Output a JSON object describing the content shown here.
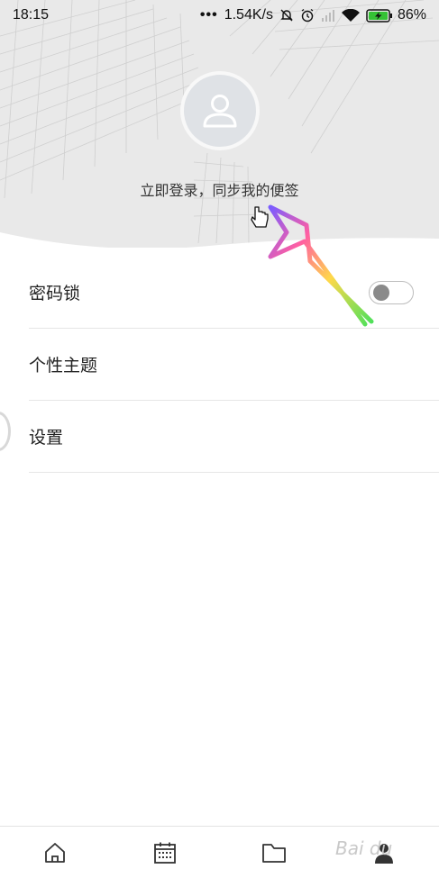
{
  "status_bar": {
    "time": "18:15",
    "dots": "•••",
    "network_speed": "1.54K/s",
    "battery_percent": "86%"
  },
  "header": {
    "login_prompt": "立即登录，同步我的便签"
  },
  "menu": {
    "items": [
      {
        "label": "密码锁",
        "has_toggle": true,
        "toggle_on": false
      },
      {
        "label": "个性主题"
      },
      {
        "label": "设置"
      }
    ]
  },
  "bottom_nav": {
    "items": [
      "home-icon",
      "calendar-icon",
      "folder-icon",
      "profile-icon"
    ]
  },
  "watermark": "Bai du",
  "colors": {
    "header_bg": "#e9e9e9",
    "avatar_bg": "#dfe2e6",
    "toggle_knob": "#8a8a8a"
  }
}
